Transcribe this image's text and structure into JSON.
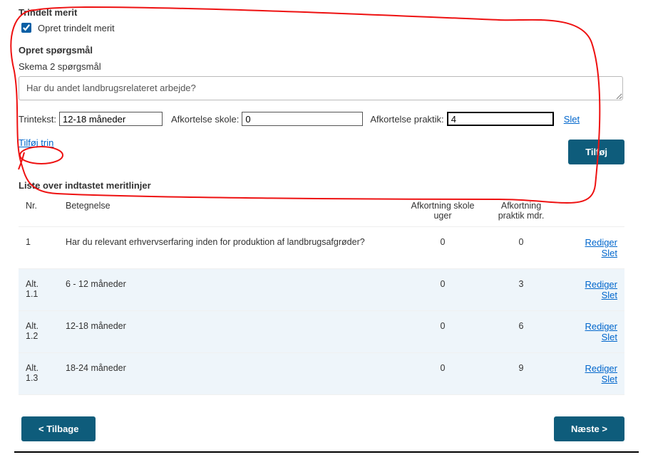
{
  "trindelt": {
    "heading": "Trindelt merit",
    "checkbox_label": "Opret trindelt merit",
    "checkbox_checked": true
  },
  "opret": {
    "heading": "Opret spørgsmål",
    "skema_label": "Skema 2 spørgsmål",
    "question_value": "Har du andet landbrugsrelateret arbejde?",
    "trintekst_label": "Trintekst:",
    "trintekst_value": "12-18 måneder",
    "afk_skole_label": "Afkortelse skole:",
    "afk_skole_value": "0",
    "afk_praktik_label": "Afkortelse praktik:",
    "afk_praktik_value": "4",
    "slet_link": "Slet",
    "tilfoj_trin_link": "Tilføj trin",
    "tilfoj_button": "Tilføj"
  },
  "liste": {
    "heading": "Liste over indtastet meritlinjer",
    "columns": {
      "nr": "Nr.",
      "betegnelse": "Betegnelse",
      "afk_skole": "Afkortning skole uger",
      "afk_praktik": "Afkortning praktik mdr."
    },
    "rows": [
      {
        "nr": "1",
        "betegnelse": "Har du relevant erhvervserfaring inden for produktion af landbrugsafgrøder?",
        "skole": "0",
        "praktik": "0",
        "alt": false
      },
      {
        "nr": "Alt. 1.1",
        "betegnelse": "6 - 12 måneder",
        "skole": "0",
        "praktik": "3",
        "alt": true
      },
      {
        "nr": "Alt. 1.2",
        "betegnelse": "12-18 måneder",
        "skole": "0",
        "praktik": "6",
        "alt": true
      },
      {
        "nr": "Alt. 1.3",
        "betegnelse": "18-24 måneder",
        "skole": "0",
        "praktik": "9",
        "alt": true
      }
    ],
    "row_actions": {
      "rediger": "Rediger",
      "slet": "Slet"
    }
  },
  "footer": {
    "back": "< Tilbage",
    "next": "Næste >"
  }
}
